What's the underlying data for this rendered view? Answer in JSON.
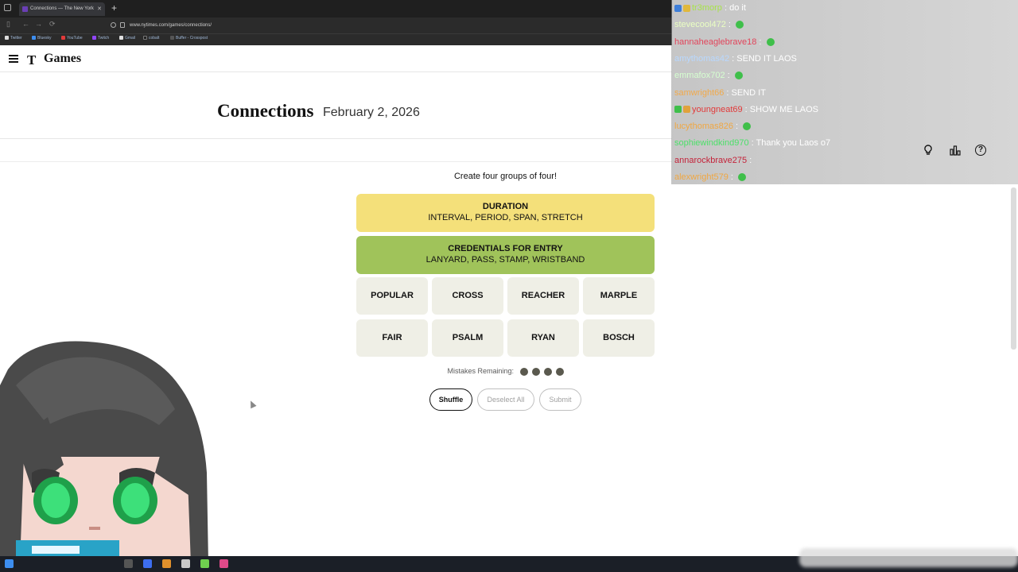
{
  "browser": {
    "tab_title": "Connections — The New York",
    "new_tab_glyph": "+",
    "close_glyph": "✕",
    "url": "www.nytimes.com/games/connections/",
    "bookmarks": [
      "Twitter",
      "Bluesky",
      "YouTube",
      "Twitch",
      "Gmail",
      "cobalt",
      "Buffer - Crosspost"
    ]
  },
  "header": {
    "logo": "T",
    "brand": "Games"
  },
  "page": {
    "title": "Connections",
    "date": "February 2, 2026"
  },
  "game": {
    "instructions": "Create four groups of four!",
    "solved_groups": [
      {
        "title": "DURATION",
        "members": "INTERVAL, PERIOD, SPAN, STRETCH",
        "color": "#f4e07a"
      },
      {
        "title": "CREDENTIALS FOR ENTRY",
        "members": "LANYARD, PASS, STAMP, WRISTBAND",
        "color": "#a0c35a"
      }
    ],
    "tiles": [
      "POPULAR",
      "CROSS",
      "REACHER",
      "MARPLE",
      "FAIR",
      "PSALM",
      "RYAN",
      "BOSCH"
    ],
    "mistakes_label": "Mistakes Remaining:",
    "mistakes_remaining": 4,
    "buttons": {
      "shuffle": "Shuffle",
      "deselect": "Deselect All",
      "submit": "Submit"
    },
    "help_glyph": "?"
  },
  "chat": [
    {
      "user": "tr3morp",
      "color": "#a8e34a",
      "msg": "do it",
      "badges": [
        "#3f7fd9",
        "#e0b83c"
      ]
    },
    {
      "user": "stevecool472",
      "color": "#eaffc2",
      "msg": "",
      "emote": true
    },
    {
      "user": "hannaheaglebrave18",
      "color": "#e2455b",
      "msg": "",
      "emote": true
    },
    {
      "user": "amythomas42",
      "color": "#b8d8ff",
      "msg": "SEND IT LAOS"
    },
    {
      "user": "emmafox702",
      "color": "#d6ffd0",
      "msg": "",
      "emote": true
    },
    {
      "user": "samwright66",
      "color": "#f1a94a",
      "msg": "SEND IT"
    },
    {
      "user": "youngneat69",
      "color": "#e23a3a",
      "msg": "SHOW ME LAOS",
      "badges": [
        "#3fbf4a",
        "#e0a23c"
      ]
    },
    {
      "user": "lucythomas826",
      "color": "#f0a742",
      "msg": "",
      "emote": true
    },
    {
      "user": "sophiewindkind970",
      "color": "#4de06a",
      "msg": "Thank you Laos o7"
    },
    {
      "user": "annarockbrave275",
      "color": "#c4233a",
      "msg": ""
    },
    {
      "user": "alexwright579",
      "color": "#f0a742",
      "msg": "",
      "emote": true
    }
  ]
}
